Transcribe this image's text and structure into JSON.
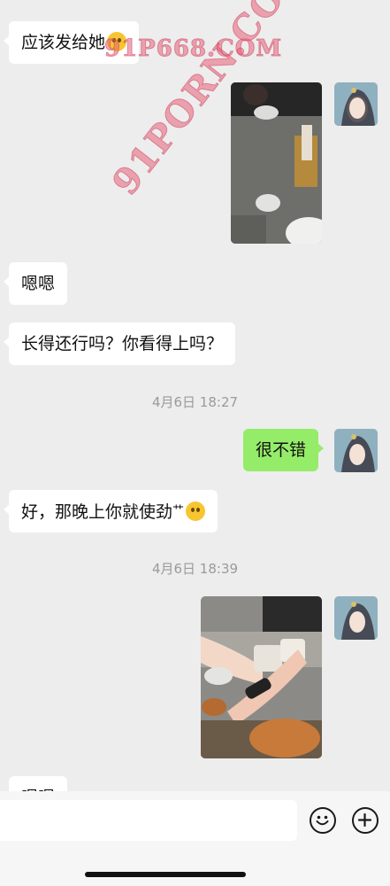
{
  "messages": {
    "m1": "应该发给她",
    "m2": "嗯嗯",
    "m3": "长得还行吗？你看得上吗？",
    "t1": "4月6日 18:27",
    "m4": "很不错",
    "m5": "好，那晚上你就使劲",
    "m5_extra": "艹",
    "t2": "4月6日 18:39",
    "m6": "嗯嗯"
  },
  "watermarks": {
    "top": "91P668.COM",
    "diagonal": "91PORN.COM"
  },
  "input": {
    "placeholder": ""
  },
  "icons": [
    "emoji-icon",
    "plus-icon",
    "grin-emoji-icon",
    "thinking-emoji-icon",
    "avatar-icon"
  ]
}
